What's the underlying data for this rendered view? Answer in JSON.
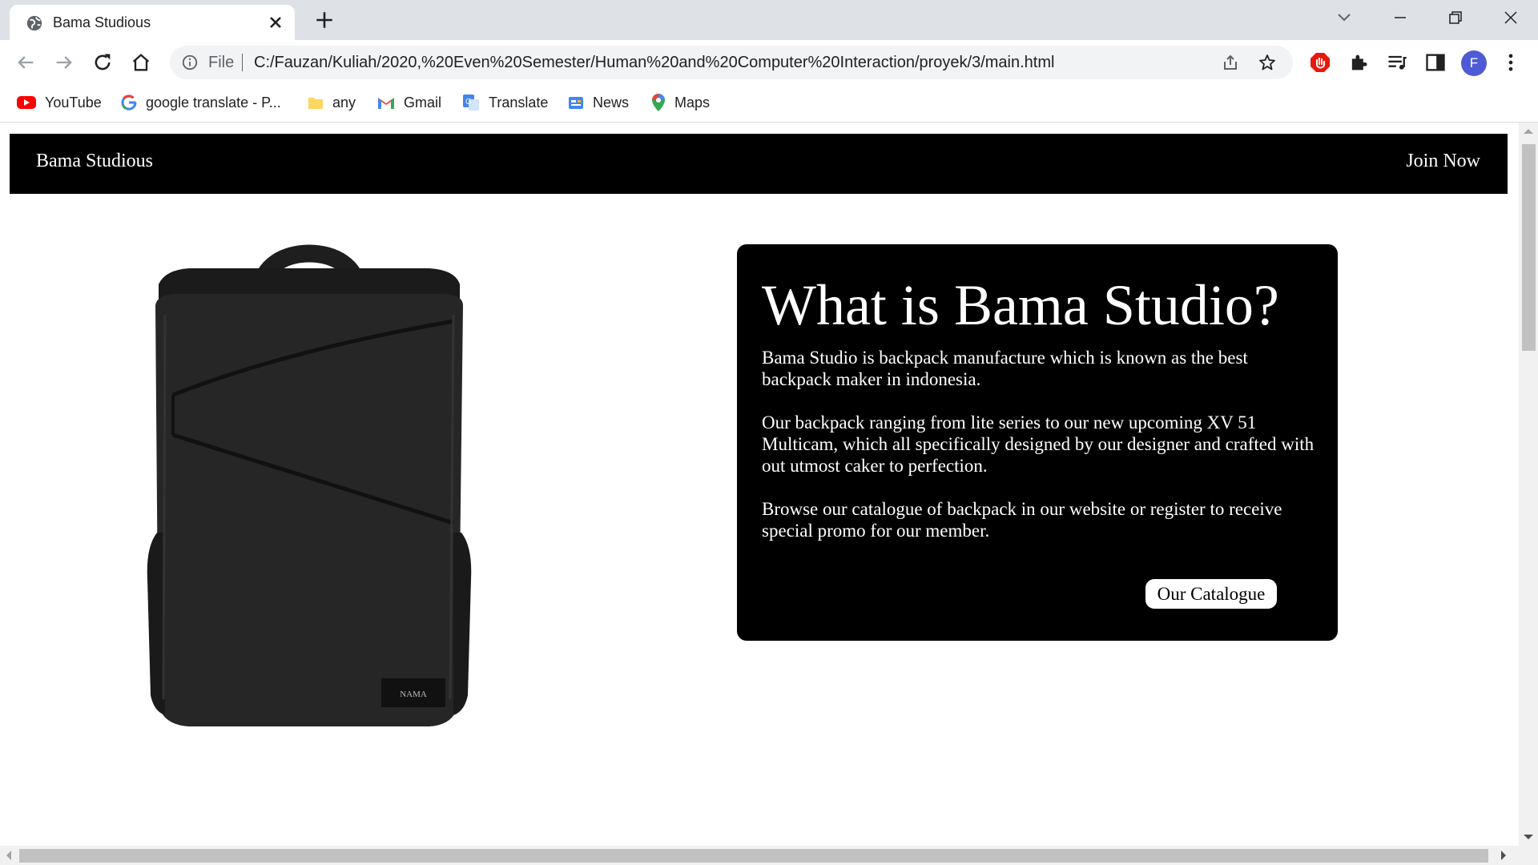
{
  "browser": {
    "tab_title": "Bama Studious",
    "omnibox": {
      "scheme_label": "File",
      "url": "C:/Fauzan/Kuliah/2020,%20Even%20Semester/Human%20and%20Computer%20Interaction/proyek/3/main.html"
    },
    "profile_initial": "F",
    "bookmarks": [
      {
        "label": "YouTube",
        "icon": "youtube-icon"
      },
      {
        "label": "google translate - P...",
        "icon": "google-icon"
      },
      {
        "label": "any",
        "icon": "folder-icon"
      },
      {
        "label": "Gmail",
        "icon": "gmail-icon"
      },
      {
        "label": "Translate",
        "icon": "translate-icon"
      },
      {
        "label": "News",
        "icon": "news-icon"
      },
      {
        "label": "Maps",
        "icon": "maps-icon"
      }
    ],
    "colors": {
      "tabstrip": "#dee1e6",
      "omnibox": "#f1f3f4",
      "profile": "#4f5bd5"
    }
  },
  "site": {
    "brand": "Bama Studious",
    "join_label": "Join Now",
    "product_image": {
      "logo_text": "NAMA",
      "icon": "backpack-image"
    },
    "info": {
      "title": "What is Bama Studio?",
      "paragraphs": [
        "Bama Studio is backpack manufacture which is known as the best backpack maker in indonesia.",
        "Our backpack ranging from lite series to our new upcoming XV 51 Multicam, which all specifically designed by our designer and crafted with out utmost caker to perfection.",
        "Browse our catalogue of backpack in our website or register to receive special promo for our member."
      ],
      "button_label": "Our Catalogue"
    },
    "colors": {
      "nav_bg": "#000000",
      "card_bg": "#000000",
      "text": "#ffffff"
    }
  }
}
